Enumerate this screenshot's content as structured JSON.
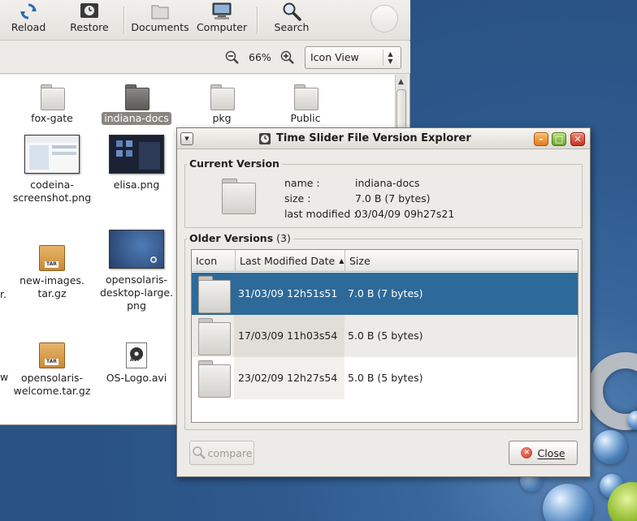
{
  "file_manager": {
    "toolbar": [
      {
        "label": "Reload",
        "icon": "reload-icon"
      },
      {
        "label": "Restore",
        "icon": "restore-icon"
      },
      {
        "label": "Documents",
        "icon": "folder-icon"
      },
      {
        "label": "Computer",
        "icon": "computer-icon"
      },
      {
        "label": "Search",
        "icon": "search-icon"
      }
    ],
    "zoom": {
      "level": "66%"
    },
    "view_mode": "Icon View",
    "items": [
      {
        "name": "fox-gate",
        "type": "folder"
      },
      {
        "name": "indiana-docs",
        "type": "folder",
        "selected": true
      },
      {
        "name": "pkg",
        "type": "folder"
      },
      {
        "name": "Public",
        "type": "folder"
      },
      {
        "name": "codeina-screenshot.png",
        "line1": "codeina-",
        "line2": "screenshot.png",
        "type": "image"
      },
      {
        "name": "elisa.png",
        "type": "image"
      },
      {
        "name": "new-images.tar.gz",
        "line1": "new-images.",
        "line2": "tar.gz",
        "type": "archive",
        "badge": "TAR"
      },
      {
        "name": "opensolaris-desktop-large.png",
        "line1": "opensolaris-",
        "line2": "desktop-large.",
        "line3": "png",
        "type": "image"
      },
      {
        "name": "opensolaris-welcome.tar.gz",
        "line1": "opensolaris-",
        "line2": "welcome.tar.gz",
        "type": "archive",
        "badge": "TAR"
      },
      {
        "name": "OS-Logo.avi",
        "type": "video",
        "badge": "AVI"
      }
    ],
    "cut_labels": [
      "r.",
      "w"
    ]
  },
  "dialog": {
    "title": "Time Slider File Version Explorer",
    "current_version": {
      "heading": "Current Version",
      "name_label": "name :",
      "name_value": "indiana-docs",
      "size_label": "size :",
      "size_value": "7.0 B (7 bytes)",
      "modified_label": "last modified :",
      "modified_value": "03/04/09 09h27s21"
    },
    "older_versions": {
      "heading": "Older Versions",
      "count": "(3)",
      "columns": [
        "Icon",
        "Last Modified Date",
        "Size"
      ],
      "sort_arrow": "▲",
      "rows": [
        {
          "date": "31/03/09 12h51s51",
          "size": "7.0 B (7 bytes)",
          "selected": true
        },
        {
          "date": "17/03/09 11h03s54",
          "size": "5.0 B (5 bytes)",
          "selected": false
        },
        {
          "date": "23/02/09 12h27s54",
          "size": "5.0 B (5 bytes)",
          "selected": false
        }
      ]
    },
    "buttons": {
      "compare": "compare",
      "close": "Close"
    }
  }
}
